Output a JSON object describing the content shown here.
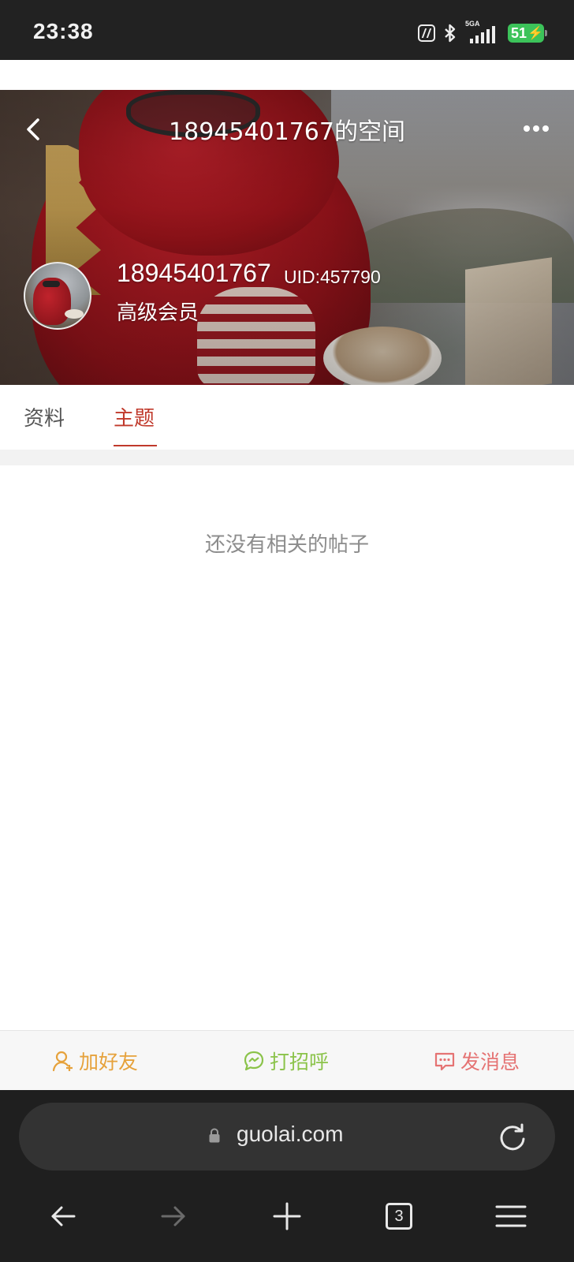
{
  "status_bar": {
    "time": "23:38",
    "network_label": "5GA",
    "battery_level": "51",
    "icons": [
      "nfc-icon",
      "bluetooth-icon",
      "signal-icon",
      "battery-charging-icon"
    ]
  },
  "header": {
    "title": "18945401767的空间",
    "back_icon": "chevron-left-icon",
    "more_icon": "more-dots-icon"
  },
  "profile": {
    "username": "18945401767",
    "uid": "UID:457790",
    "member_level": "高级会员"
  },
  "tabs": [
    {
      "label": "资料",
      "active": false
    },
    {
      "label": "主题",
      "active": true
    }
  ],
  "content": {
    "empty_message": "还没有相关的帖子"
  },
  "actions": {
    "add_friend": "加好友",
    "greet": "打招呼",
    "send_message": "发消息",
    "colors": {
      "add_friend": "#e6a23c",
      "greet": "#8bc34a",
      "send_message": "#e57373"
    }
  },
  "browser": {
    "url": "guolai.com",
    "tab_count": "3",
    "icons": [
      "lock-icon",
      "reload-icon",
      "back-arrow-icon",
      "forward-arrow-icon",
      "plus-icon",
      "tabs-icon",
      "menu-icon"
    ]
  },
  "colors": {
    "accent": "#c0392b",
    "status_bar_bg": "#222222",
    "browser_bar_bg": "#1f1f1f"
  }
}
